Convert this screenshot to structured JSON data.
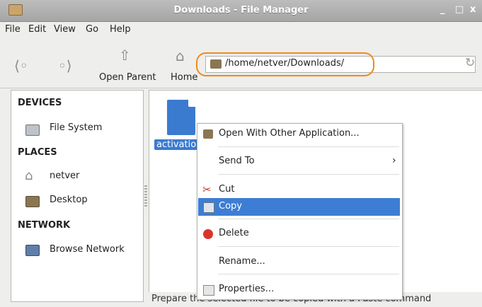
{
  "window": {
    "title": "Downloads - File Manager",
    "minimize": "_",
    "maximize": "□",
    "close": "x"
  },
  "menubar": {
    "items": [
      "File",
      "Edit",
      "View",
      "Go",
      "Help"
    ]
  },
  "toolbar": {
    "back_label": "",
    "forward_label": "",
    "open_parent_label": "Open Parent",
    "home_label": "Home",
    "address": "/home/netver/Downloads/"
  },
  "sidebar": {
    "devices_header": "DEVICES",
    "file_system": "File System",
    "places_header": "PLACES",
    "netver": "netver",
    "desktop": "Desktop",
    "network_header": "NETWORK",
    "browse_network": "Browse Network"
  },
  "content": {
    "file_label": "activatio"
  },
  "context_menu": {
    "open_with": "Open With Other Application...",
    "send_to": "Send To",
    "send_to_arrow": "›",
    "cut": "Cut",
    "copy": "Copy",
    "delete": "Delete",
    "rename": "Rename...",
    "properties": "Properties..."
  },
  "status": {
    "text": "Prepare the selected file to be copied with a Paste command"
  },
  "colors": {
    "highlight": "#3d7ed4",
    "address_outline": "#f08a1c",
    "file_icon": "#3a7bd0"
  }
}
